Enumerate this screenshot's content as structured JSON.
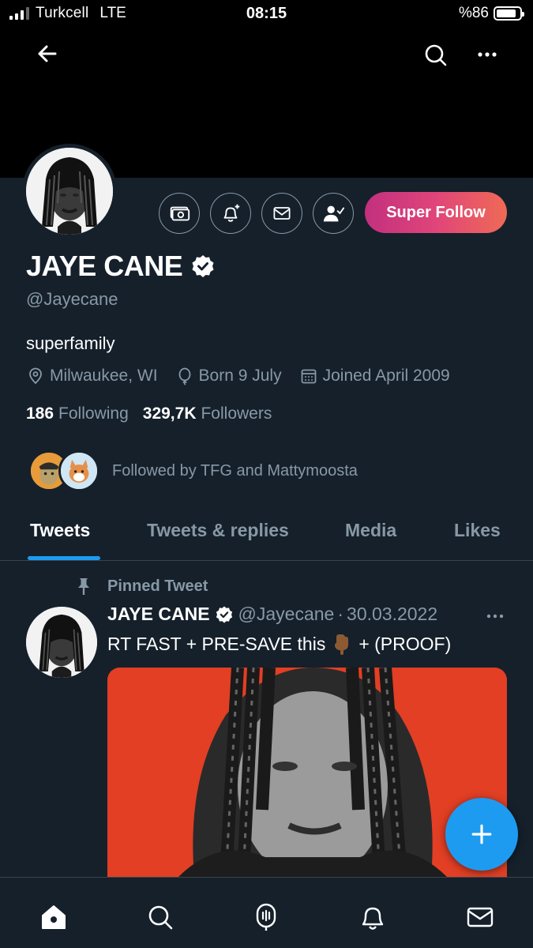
{
  "status_bar": {
    "carrier": "Turkcell",
    "network": "LTE",
    "time": "08:15",
    "battery": "%86",
    "battery_level": 0.86
  },
  "profile": {
    "display_name": "JAYE CANE",
    "handle": "@Jayecane",
    "bio": "superfamily",
    "location": "Milwaukee, WI",
    "born": "Born 9 July",
    "joined": "Joined April 2009",
    "following_count": "186",
    "following_label": "Following",
    "followers_count": "329,7K",
    "followers_label": "Followers",
    "followed_by_text": "Followed by TFG and Mattymoosta",
    "super_follow_label": "Super Follow"
  },
  "tabs": [
    {
      "label": "Tweets",
      "active": true
    },
    {
      "label": "Tweets & replies",
      "active": false
    },
    {
      "label": "Media",
      "active": false
    },
    {
      "label": "Likes",
      "active": false
    }
  ],
  "tweet": {
    "pinned_label": "Pinned Tweet",
    "author_name": "JAYE CANE",
    "author_handle": "@Jayecane",
    "separator": "·",
    "date": "30.03.2022",
    "text_before": "RT FAST + PRE-SAVE this",
    "text_after": "+ (PROOF)"
  },
  "colors": {
    "background": "#15202b",
    "banner": "#000000",
    "accent": "#1d9bf0",
    "muted_text": "#8899a6",
    "media_bg": "#e23f24"
  },
  "icons": {
    "nav": [
      "back-arrow-icon",
      "search-icon",
      "more-icon"
    ],
    "actions": [
      "super-follow-money-icon",
      "notification-bell-add-icon",
      "message-envelope-icon",
      "following-person-check-icon"
    ],
    "bottom_nav": [
      "home-icon",
      "search-icon",
      "spaces-mic-icon",
      "notifications-bell-icon",
      "messages-envelope-icon"
    ]
  }
}
